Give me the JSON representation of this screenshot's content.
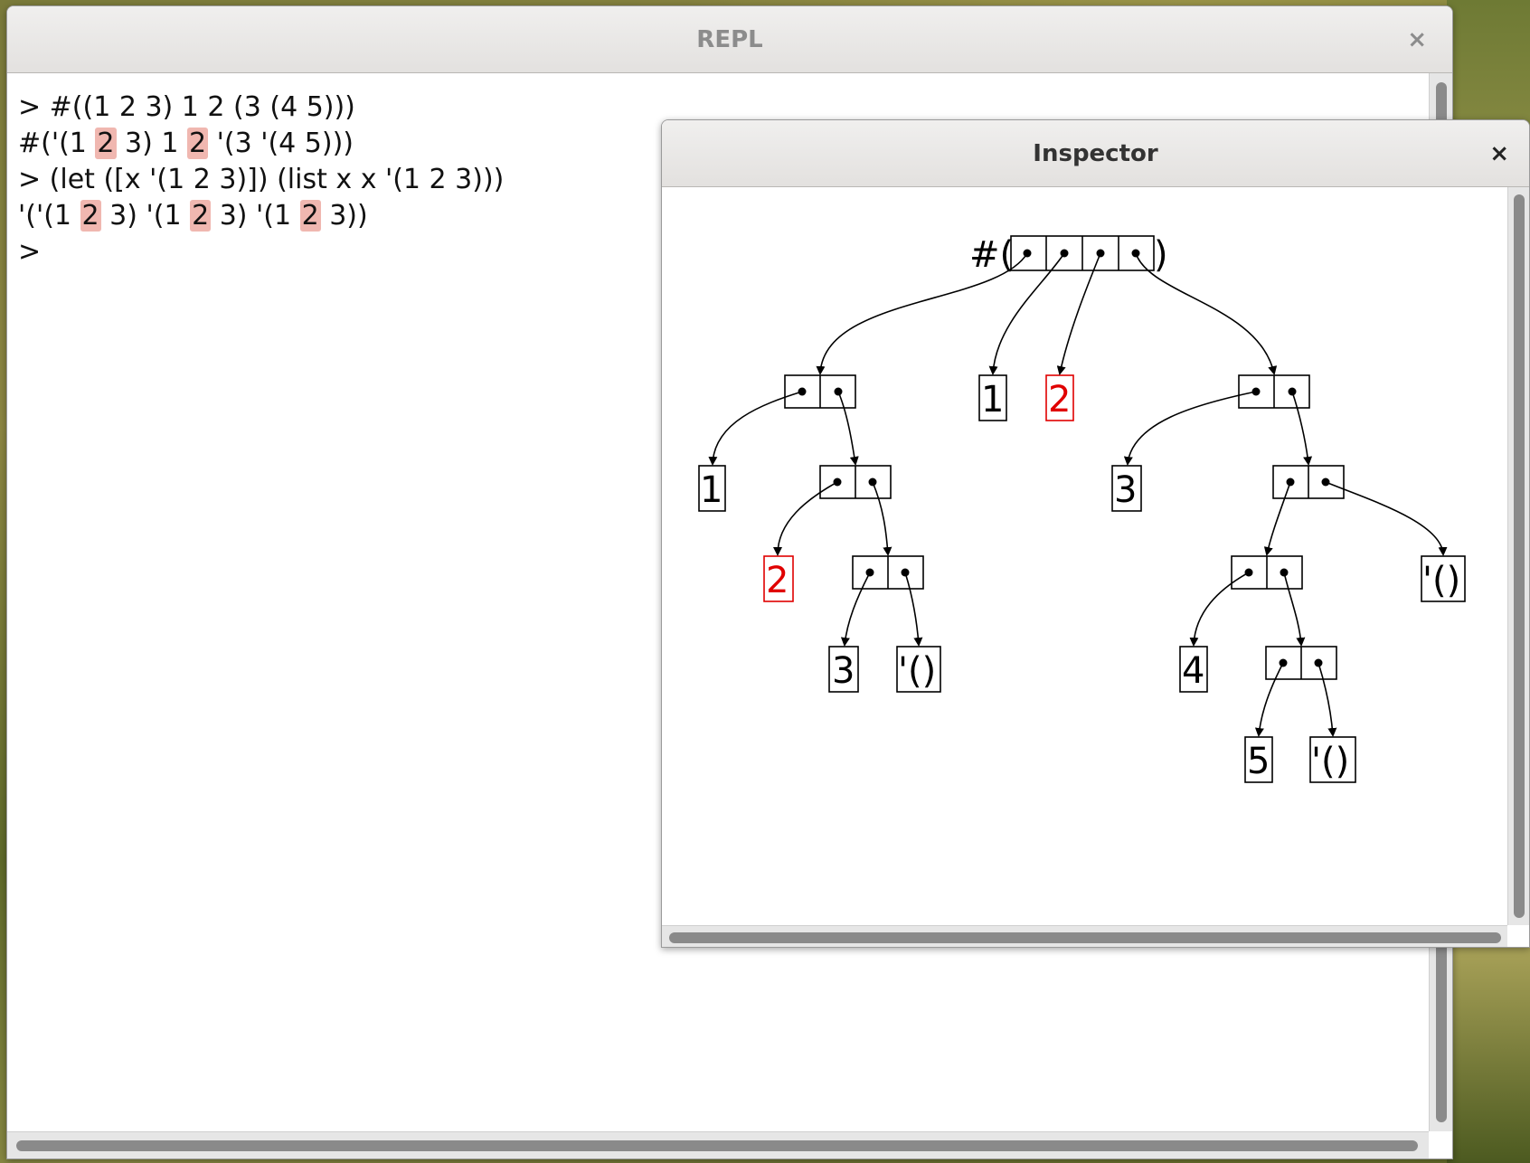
{
  "repl": {
    "title": "REPL",
    "close_glyph": "×",
    "lines": [
      [
        {
          "t": "> #((1 2 3) 1 2 (3 (4 5)))"
        }
      ],
      [
        {
          "t": "#('(1 "
        },
        {
          "t": "2",
          "hl": true
        },
        {
          "t": " 3) 1 "
        },
        {
          "t": "2",
          "hl": true
        },
        {
          "t": " '(3 '(4 5)))"
        }
      ],
      [
        {
          "t": "> (let ([x '(1 2 3)]) (list x x '(1 2 3)))"
        }
      ],
      [
        {
          "t": "'('(1 "
        },
        {
          "t": "2",
          "hl": true
        },
        {
          "t": " 3) '(1 "
        },
        {
          "t": "2",
          "hl": true
        },
        {
          "t": " 3) '(1 "
        },
        {
          "t": "2",
          "hl": true
        },
        {
          "t": " 3))"
        }
      ],
      [
        {
          "t": ">"
        }
      ]
    ],
    "highlight_color": "#f0b7b0"
  },
  "inspector": {
    "title": "Inspector",
    "close_glyph": "×",
    "vector_prefix": "#(",
    "vector_suffix": ")",
    "atoms": {
      "a1": "1",
      "a2": "2",
      "a1top": "1",
      "a2top": "2",
      "a3": "3",
      "nil1": "'()",
      "b3": "3",
      "b4": "4",
      "b5": "5",
      "nil2": "'()",
      "nil3": "'()"
    },
    "highlight_color": "#e00000"
  }
}
